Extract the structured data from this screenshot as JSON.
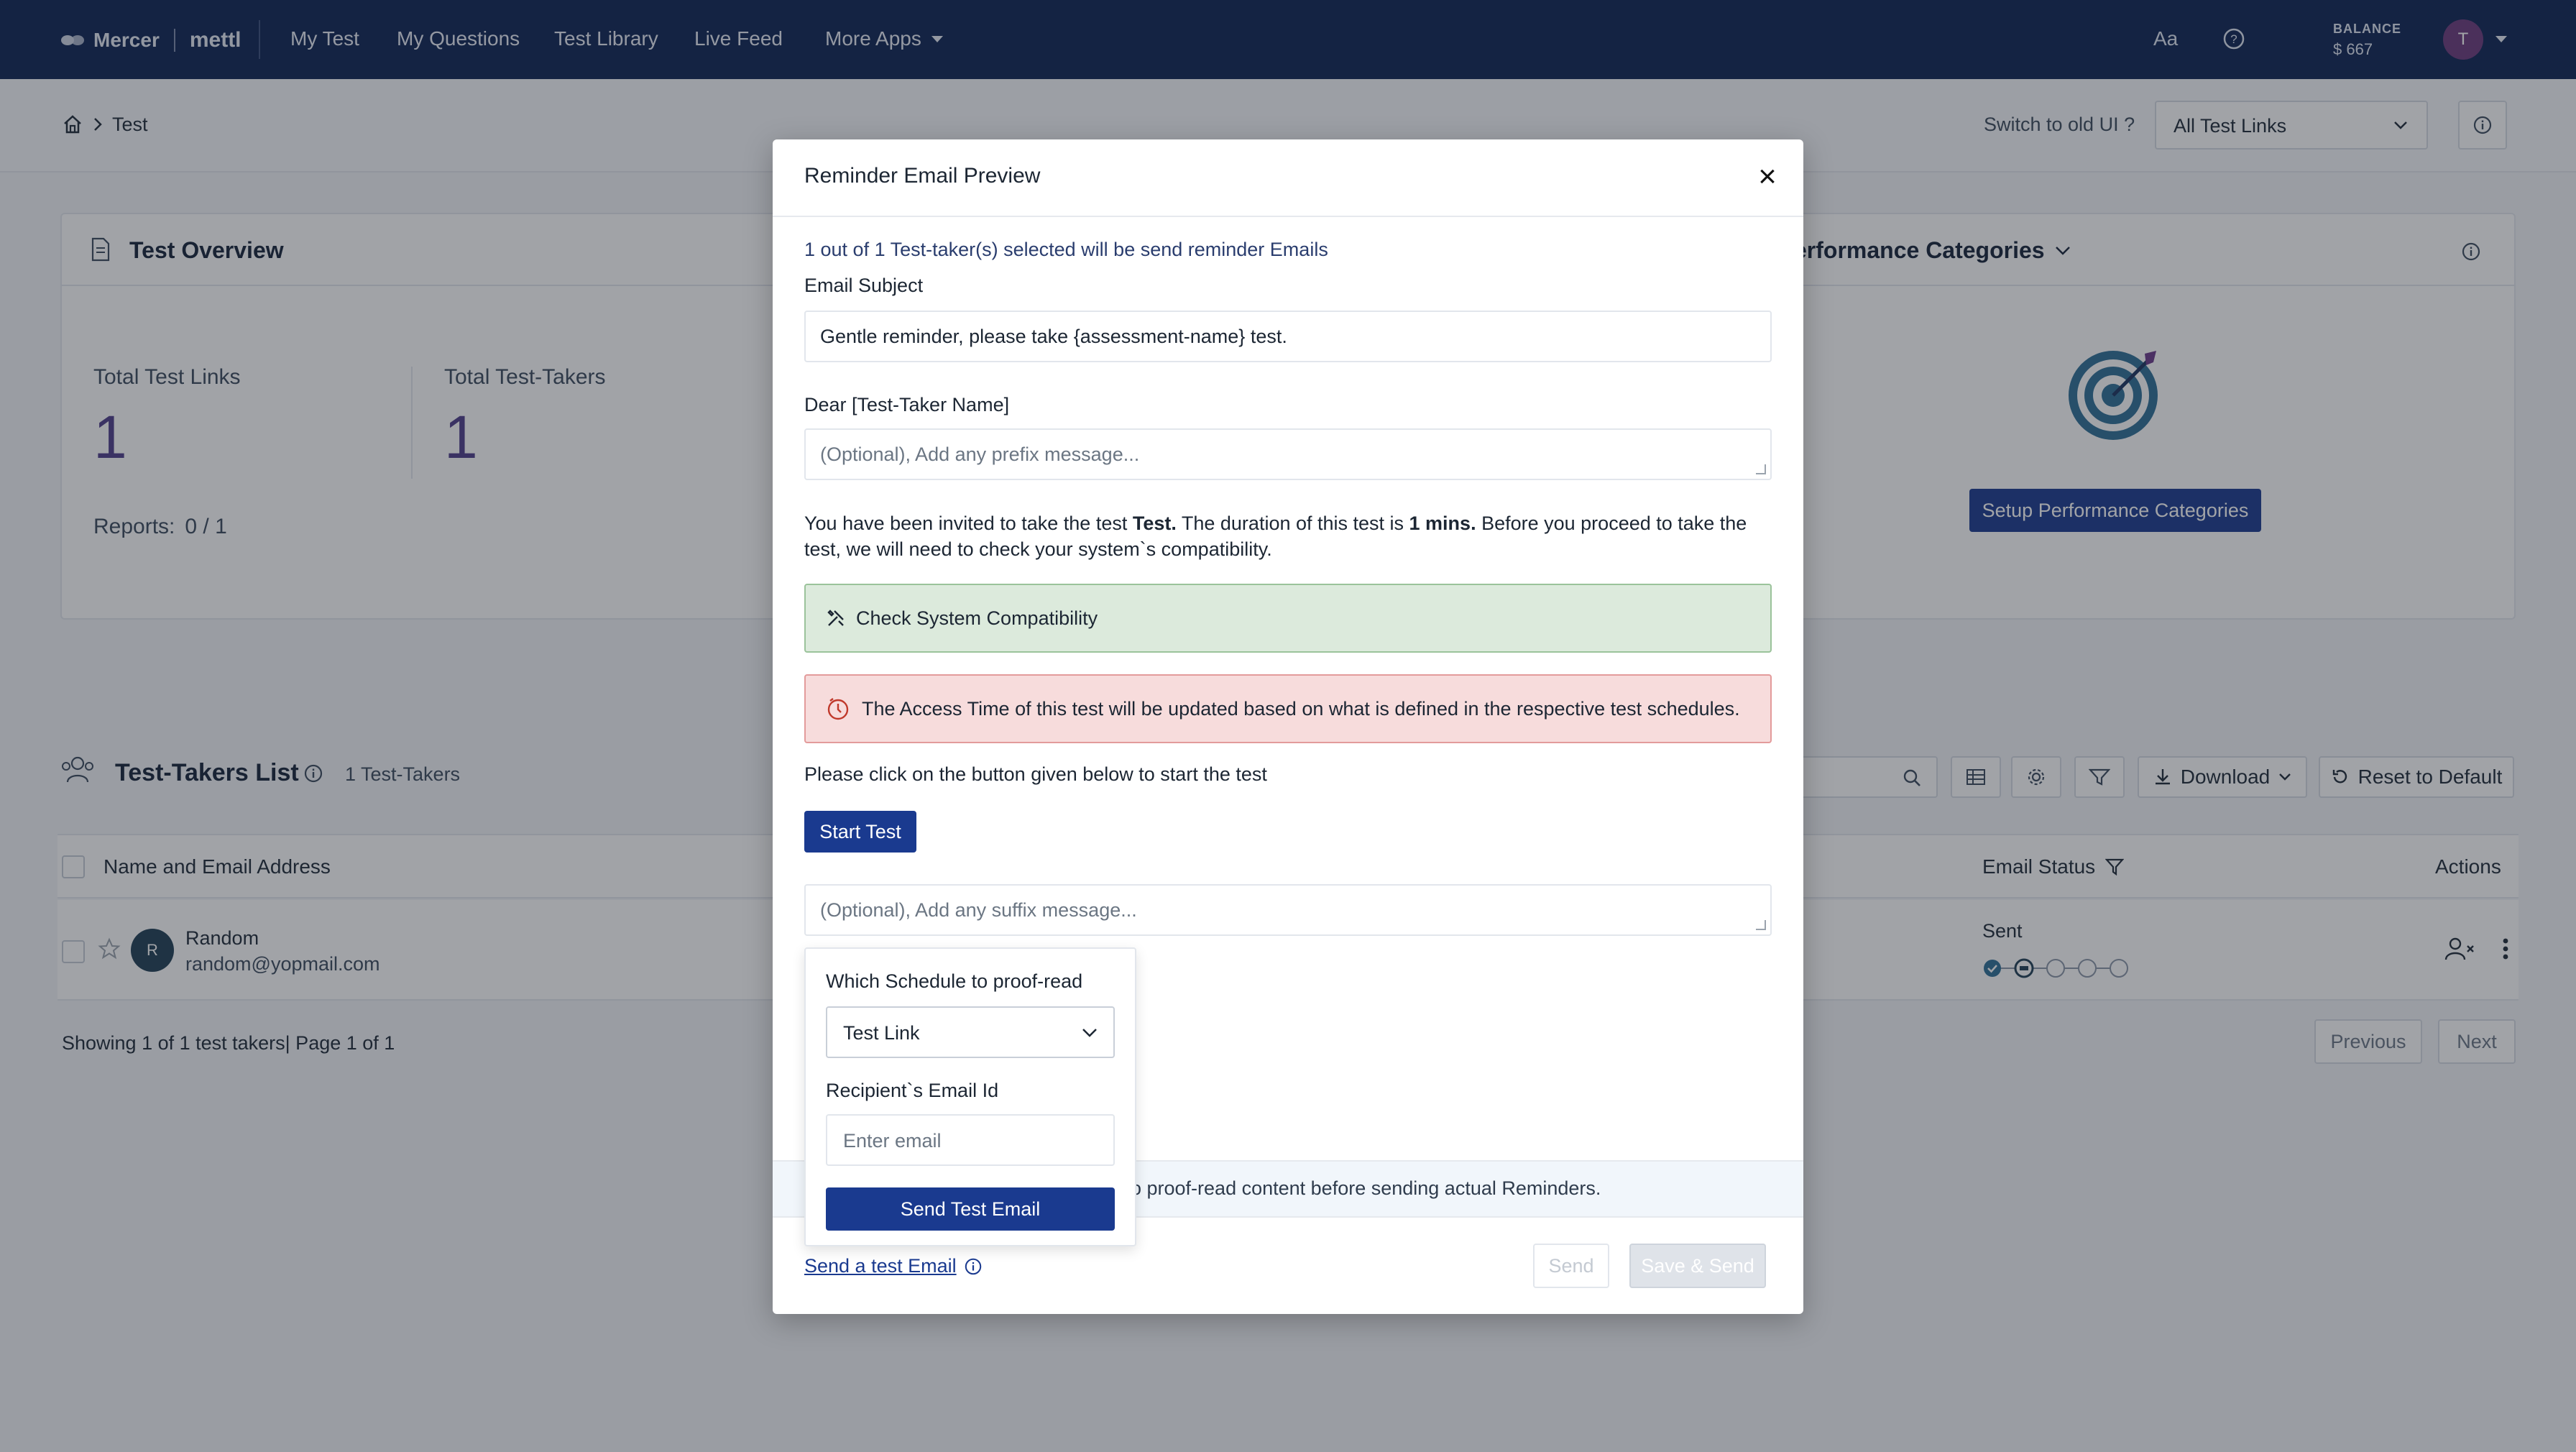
{
  "topnav": {
    "brand": "Mercer",
    "brand_product": "mettl",
    "items": [
      "My Test",
      "My Questions",
      "Test Library",
      "Live Feed",
      "More Apps"
    ],
    "font_size_label": "Aa",
    "balance_label": "BALANCE",
    "balance_value": "$ 667",
    "avatar_initial": "T"
  },
  "breadcrumb": {
    "current": "Test"
  },
  "subbar": {
    "switch_old_ui": "Switch to old UI ?",
    "test_links_select": "All Test Links"
  },
  "overview": {
    "title": "Test Overview",
    "total_links_label": "Total Test Links",
    "total_links_value": "1",
    "total_takers_label": "Total Test-Takers",
    "total_takers_value": "1",
    "reports_label": "Reports:",
    "reports_value": "0 / 1"
  },
  "performance": {
    "title": "erformance Categories",
    "setup_button": "Setup Performance Categories"
  },
  "takers_list": {
    "title": "Test-Takers List",
    "count": "1 Test-Takers",
    "download_label": "Download",
    "reset_label": "Reset to Default",
    "columns": {
      "name": "Name and Email Address",
      "email_status": "Email Status",
      "actions": "Actions"
    },
    "rows": [
      {
        "initial": "R",
        "name": "Random",
        "email": "random@yopmail.com",
        "status": "Sent"
      }
    ],
    "footer": "Showing 1 of 1 test takers| Page 1 of 1",
    "previous": "Previous",
    "next": "Next"
  },
  "modal": {
    "title": "Reminder Email Preview",
    "close": "×",
    "selection_info": "1 out of 1 Test-taker(s) selected will be send reminder Emails",
    "subject_label": "Email Subject",
    "subject_value": "Gentle reminder, please take {assessment-name} test.",
    "greeting": "Dear [Test-Taker Name]",
    "prefix_placeholder": "(Optional), Add any prefix message...",
    "para_a": "You have been invited to take the test ",
    "para_test": "Test.",
    "para_b": " The duration of this test is ",
    "para_duration": "1 mins.",
    "para_c": " Before you proceed to take the test, we will need to check your system`s compatibility.",
    "compat_label": "Check System Compatibility",
    "access_notice": "The Access Time of this test will be updated based on what is defined in the respective test schedules.",
    "click_instruction": "Please click on the button given below to start the test",
    "start_button": "Start Test",
    "suffix_placeholder": "(Optional), Add any suffix message...",
    "proof_text": "o proof-read content before sending actual Reminders.",
    "send_test_link": "Send a test Email",
    "send_button": "Send",
    "save_send_button": "Save & Send",
    "popover": {
      "schedule_label": "Which Schedule to proof-read",
      "schedule_value": "Test Link",
      "email_label": "Recipient`s Email Id",
      "email_placeholder": "Enter email",
      "send_button": "Send Test Email"
    }
  },
  "colors": {
    "nav_bg": "#0d2453",
    "primary": "#1a3a8f",
    "success_bg": "#dceadc",
    "danger_bg": "#f7dcdc",
    "metric": "#4f3d8a"
  }
}
